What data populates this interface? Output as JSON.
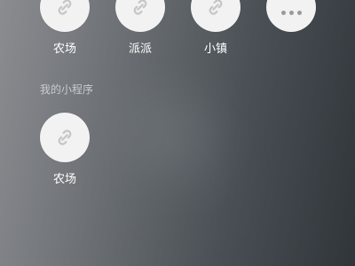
{
  "recent_apps": [
    {
      "label": "农场",
      "icon": "mini-program-link-icon"
    },
    {
      "label": "派派",
      "icon": "mini-program-link-icon"
    },
    {
      "label": "小镇",
      "icon": "mini-program-link-icon"
    },
    {
      "label": "",
      "icon": "more-dots-icon"
    }
  ],
  "my_programs": {
    "title": "我的小程序",
    "apps": [
      {
        "label": "农场",
        "icon": "mini-program-link-icon"
      }
    ]
  },
  "colors": {
    "icon_bg": "#f2f2f2",
    "icon_glyph": "#c6c6c6",
    "label_text": "#ffffff",
    "section_title": "#c8ccd0"
  }
}
